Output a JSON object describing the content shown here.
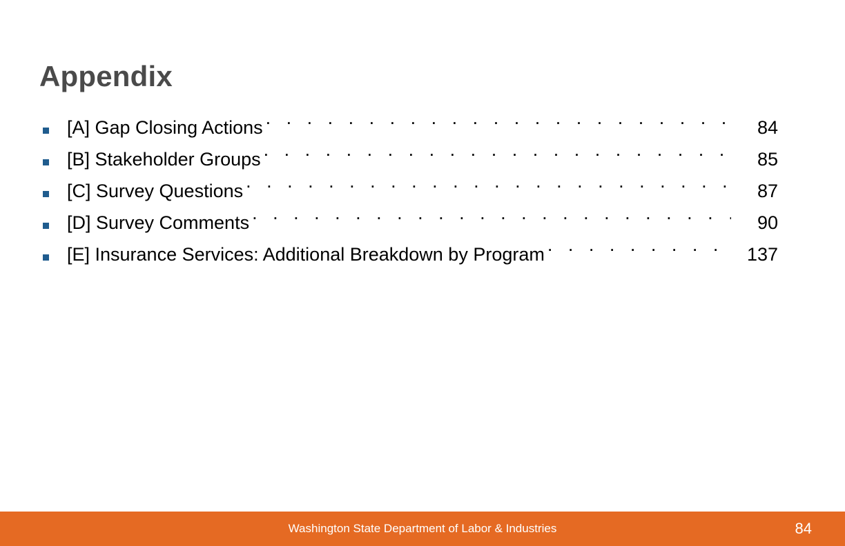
{
  "slide": {
    "title": "Appendix",
    "title_color": "#4a4a4a",
    "background_color": "#ffffff"
  },
  "toc": {
    "bullet_icon": "square-bullet-icon",
    "bullet_color": "#1f5c8e",
    "leader_dots": ". . . . . . . . . . . . . . . . . . . . . . . . . . . . . . . . . . . . . . . . . . . . . . . . . . . . . . . . . . . . . . . .",
    "entries": [
      {
        "label": "[A] Gap Closing Actions",
        "page": "84"
      },
      {
        "label": "[B] Stakeholder Groups",
        "page": "85"
      },
      {
        "label": "[C] Survey Questions",
        "page": "87"
      },
      {
        "label": "[D] Survey Comments",
        "page": "90"
      },
      {
        "label": "[E] Insurance Services: Additional Breakdown by Program",
        "page": "137"
      }
    ]
  },
  "footer": {
    "organization": "Washington State Department of Labor & Industries",
    "page_number": "84",
    "bar_color": "#e56a23",
    "text_color": "#ffffff"
  }
}
